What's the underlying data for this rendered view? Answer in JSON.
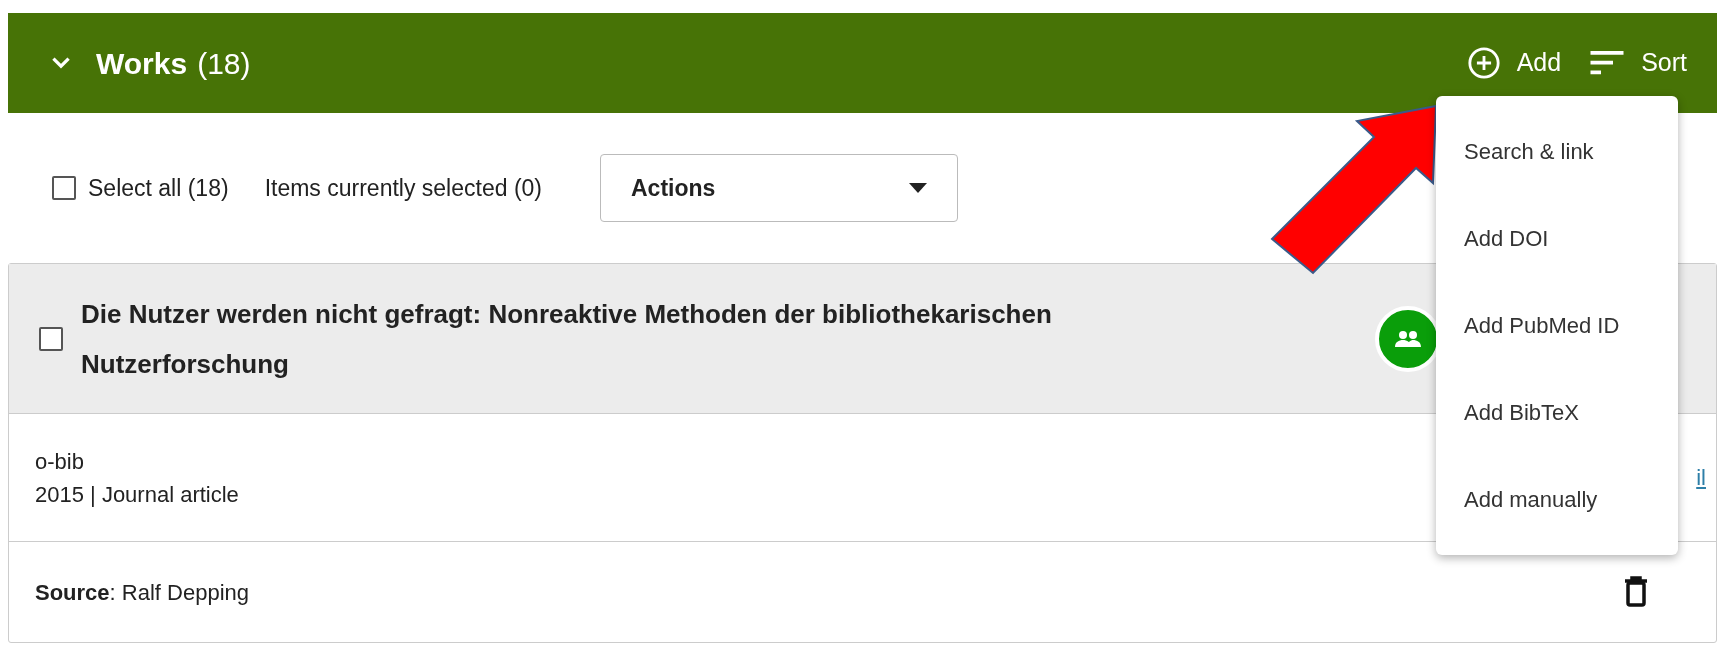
{
  "section": {
    "title": "Works",
    "count": "(18)",
    "expanded": true,
    "actions": [
      {
        "kind": "add",
        "label": "Add"
      },
      {
        "kind": "sort",
        "label": "Sort"
      }
    ]
  },
  "toolbar": {
    "select_all": {
      "label": "Select all (18)",
      "checked": false
    },
    "selected_info": "Items currently selected (0)",
    "actions_dropdown": "Actions"
  },
  "add_menu": {
    "items": [
      "Search & link",
      "Add DOI",
      "Add PubMed ID",
      "Add BibTeX",
      "Add manually"
    ]
  },
  "work": {
    "title": "Die Nutzer werden nicht gefragt: Nonreaktive Methoden der bibliothekarischen Nutzerforschung",
    "checked": false,
    "journal": "o-bib",
    "meta": "2015 | Journal article",
    "link": "il",
    "source": "**Source**: Ralf Depping"
  }
}
